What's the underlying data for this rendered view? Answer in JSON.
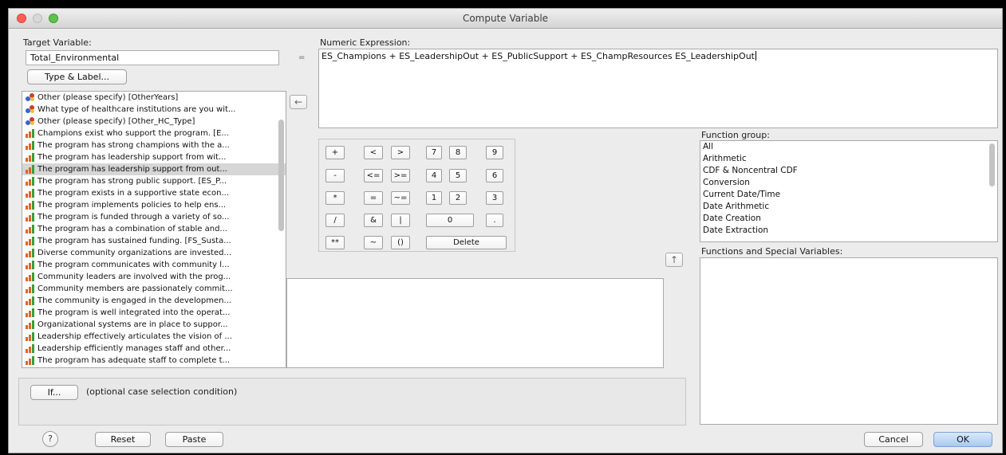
{
  "window": {
    "title": "Compute Variable"
  },
  "target": {
    "label": "Target Variable:",
    "value": "Total_Environmental",
    "type_label_button": "Type & Label...",
    "equals": "="
  },
  "variables": [
    {
      "type": "nominal",
      "label": "Other (please specify) [OtherYears]"
    },
    {
      "type": "nominal",
      "label": "What type of healthcare institutions are you wit..."
    },
    {
      "type": "nominal",
      "label": "Other (please specify) [Other_HC_Type]"
    },
    {
      "type": "ordinal",
      "label": "Champions exist who support the program. [E..."
    },
    {
      "type": "ordinal",
      "label": "The program has strong champions with the a..."
    },
    {
      "type": "ordinal",
      "label": "The program has leadership support from wit..."
    },
    {
      "type": "ordinal",
      "label": "The program has leadership support from out...",
      "selected": true
    },
    {
      "type": "ordinal",
      "label": "The program has strong public support. [ES_P..."
    },
    {
      "type": "ordinal",
      "label": "The program exists in a supportive state econ..."
    },
    {
      "type": "ordinal",
      "label": "The program implements policies to help ens..."
    },
    {
      "type": "ordinal",
      "label": "The program is funded through a variety of so..."
    },
    {
      "type": "ordinal",
      "label": "The program has a combination of stable and..."
    },
    {
      "type": "ordinal",
      "label": "The program has sustained funding. [FS_Susta..."
    },
    {
      "type": "ordinal",
      "label": "Diverse community organizations are invested..."
    },
    {
      "type": "ordinal",
      "label": "The program communicates with community l..."
    },
    {
      "type": "ordinal",
      "label": "Community leaders are involved with the prog..."
    },
    {
      "type": "ordinal",
      "label": "Community members are passionately commit..."
    },
    {
      "type": "ordinal",
      "label": "The community is engaged in the developmen..."
    },
    {
      "type": "ordinal",
      "label": "The program is well integrated into the operat..."
    },
    {
      "type": "ordinal",
      "label": "Organizational systems are in place to suppor..."
    },
    {
      "type": "ordinal",
      "label": "Leadership effectively articulates the vision of ..."
    },
    {
      "type": "ordinal",
      "label": "Leadership efficiently manages staff and other..."
    },
    {
      "type": "ordinal",
      "label": "The program has adequate staff to complete t..."
    }
  ],
  "expression": {
    "label": "Numeric Expression:",
    "value": "ES_Champions + ES_LeadershipOut + ES_PublicSupport + ES_ChampResources ES_LeadershipOut"
  },
  "keypad": {
    "plus": "+",
    "lt": "<",
    "gt": ">",
    "k7": "7",
    "k8": "8",
    "k9": "9",
    "minus": "-",
    "le": "<=",
    "ge": ">=",
    "k4": "4",
    "k5": "5",
    "k6": "6",
    "mul": "*",
    "eq": "=",
    "ne": "~=",
    "k1": "1",
    "k2": "2",
    "k3": "3",
    "div": "/",
    "and": "&",
    "or": "|",
    "k0": "0",
    "dot": ".",
    "pow": "**",
    "not": "~",
    "paren": "()",
    "delete": "Delete"
  },
  "function_group": {
    "label": "Function group:",
    "items": [
      "All",
      "Arithmetic",
      "CDF & Noncentral CDF",
      "Conversion",
      "Current Date/Time",
      "Date Arithmetic",
      "Date Creation",
      "Date Extraction"
    ]
  },
  "functions_special": {
    "label": "Functions and Special Variables:"
  },
  "if_section": {
    "button": "If...",
    "description": "(optional case selection condition)"
  },
  "footer": {
    "help": "?",
    "reset": "Reset",
    "paste": "Paste",
    "cancel": "Cancel",
    "ok": "OK"
  },
  "icons": {
    "move_left": "arrow-left-icon",
    "move_up": "arrow-up-icon",
    "nominal": "nominal-variable-icon",
    "ordinal": "ordinal-variable-icon"
  }
}
